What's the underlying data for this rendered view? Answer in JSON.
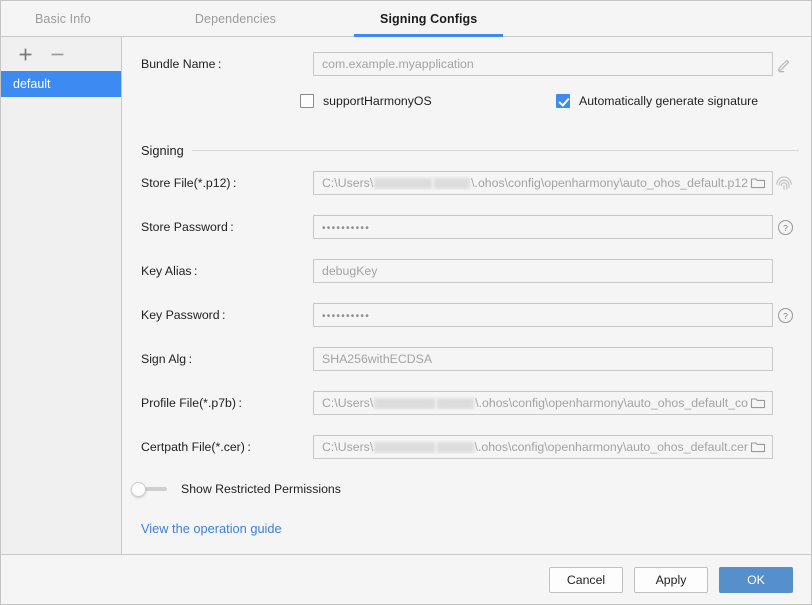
{
  "tabs": [
    {
      "label": "Basic Info",
      "active": false
    },
    {
      "label": "Dependencies",
      "active": false
    },
    {
      "label": "Signing Configs",
      "active": true
    }
  ],
  "sidebar": {
    "add_label": "+",
    "remove_label": "−",
    "items": [
      {
        "label": "default",
        "selected": true
      }
    ]
  },
  "form": {
    "bundle_name": {
      "label": "Bundle Name :",
      "placeholder": "com.example.myapplication",
      "value": "com.example.myapplication",
      "edit_icon": "pencil-icon"
    },
    "checkboxes": [
      {
        "label": "supportHarmonyOS",
        "checked": false
      },
      {
        "label": "Automatically generate signature",
        "checked": true
      }
    ],
    "section_title": "Signing",
    "store_file": {
      "label": "Store File(*.p12) :",
      "prefix": "C:\\Users\\",
      "suffix": "\\.ohos\\config\\openharmony\\auto_ohos_default.p12",
      "redacted": true,
      "browse_icon": "folder-icon",
      "side_icon": "fingerprint-icon"
    },
    "store_password": {
      "label": "Store Password :",
      "value": "••••••••••",
      "help_icon": "question-circle-icon"
    },
    "key_alias": {
      "label": "Key Alias :",
      "value": "debugKey"
    },
    "key_password": {
      "label": "Key Password :",
      "value": "••••••••••",
      "help_icon": "question-circle-icon"
    },
    "sign_alg": {
      "label": "Sign Alg :",
      "value": "SHA256withECDSA"
    },
    "profile_file": {
      "label": "Profile File(*.p7b) :",
      "prefix": "C:\\Users\\",
      "suffix": "\\.ohos\\config\\openharmony\\auto_ohos_default_co",
      "redacted": true,
      "browse_icon": "folder-icon"
    },
    "certpath_file": {
      "label": "Certpath File(*.cer) :",
      "prefix": "C:\\Users\\",
      "suffix": "\\.ohos\\config\\openharmony\\auto_ohos_default.cer",
      "redacted": true,
      "browse_icon": "folder-icon"
    },
    "restricted_toggle": {
      "label": "Show Restricted Permissions",
      "on": false
    },
    "guide_link": "View the operation guide"
  },
  "footer": {
    "cancel": "Cancel",
    "apply": "Apply",
    "ok": "OK"
  },
  "colors": {
    "accent": "#3d8bf2",
    "primary_button": "#5590cd",
    "link": "#3d7fe0",
    "window_bg": "#f5f5f5",
    "sidebar_bg": "#f0f0f0"
  }
}
